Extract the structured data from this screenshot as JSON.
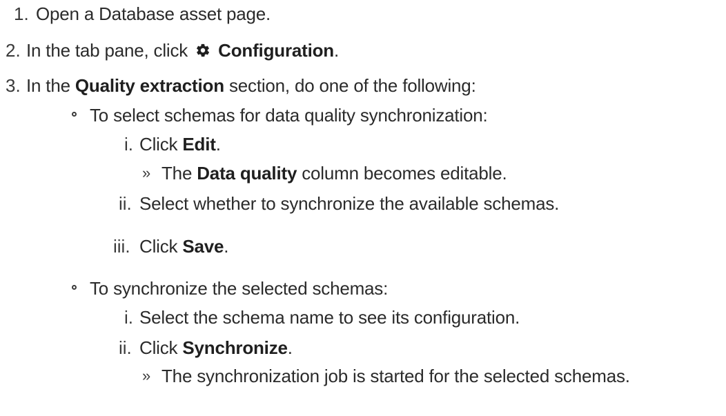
{
  "steps": [
    {
      "marker": "1.",
      "text": "Open a Database asset page."
    },
    {
      "marker": "2.",
      "prefix": "In the tab pane, click",
      "icon": "gear-icon",
      "bold": "Configuration",
      "suffix": "."
    },
    {
      "marker": "3.",
      "prefix": "In the",
      "bold": "Quality extraction",
      "suffix": "section, do one of the following:"
    }
  ],
  "options": [
    {
      "text": "To select schemas for data quality synchronization:",
      "substeps": [
        {
          "marker": "i.",
          "prefix": "Click",
          "bold": "Edit",
          "suffix": ".",
          "result": {
            "marker": "»",
            "prefix": "The",
            "bold": "Data quality",
            "suffix": "column becomes editable."
          }
        },
        {
          "marker": "ii.",
          "text": "Select whether to synchronize the available schemas."
        },
        {
          "marker": "iii.",
          "prefix": "Click",
          "bold": "Save",
          "suffix": "."
        }
      ]
    },
    {
      "text": "To synchronize the selected schemas:",
      "substeps": [
        {
          "marker": "i.",
          "text": "Select the schema name to see its configuration."
        },
        {
          "marker": "ii.",
          "prefix": "Click",
          "bold": "Synchronize",
          "suffix": ".",
          "result": {
            "marker": "»",
            "text": "The synchronization job is started for the selected schemas."
          }
        }
      ]
    }
  ]
}
